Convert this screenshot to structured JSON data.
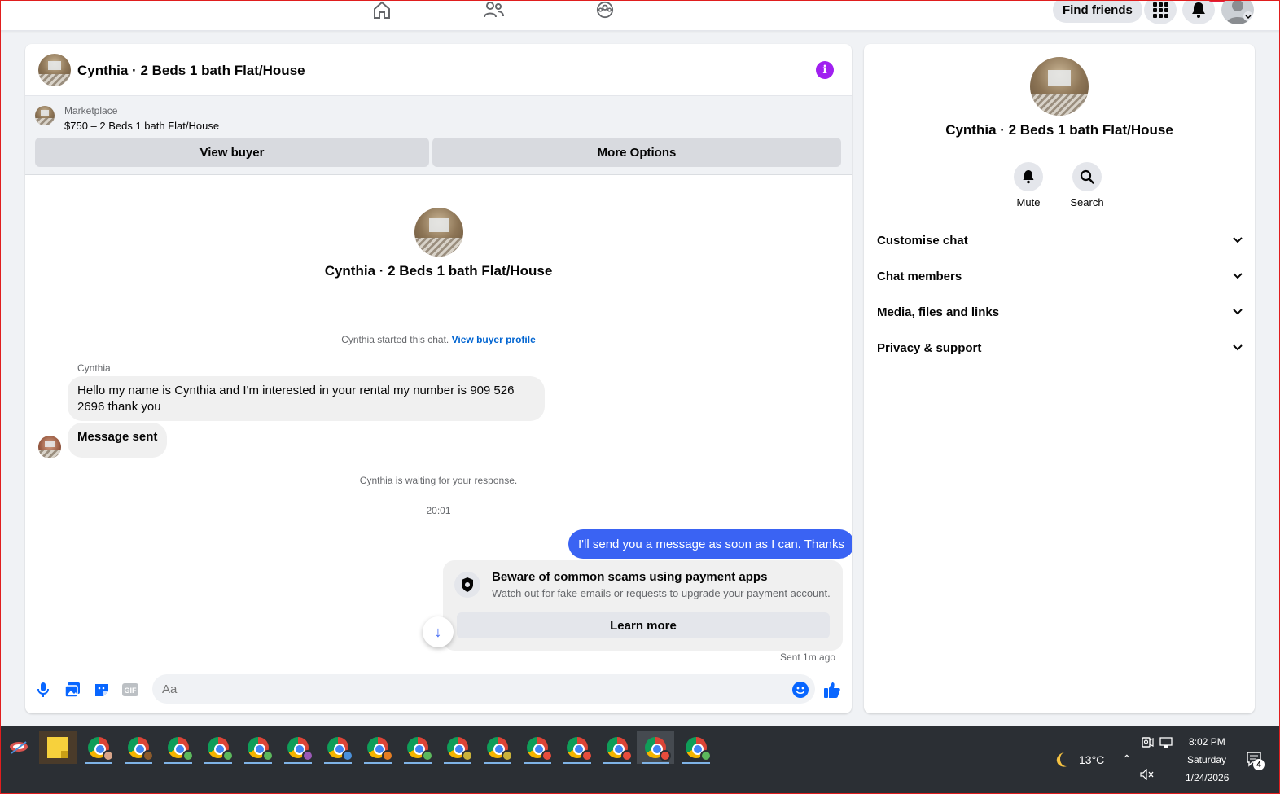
{
  "top_nav": {
    "find_friends_label": "Find friends"
  },
  "chat": {
    "title": "Cynthia · 2 Beds 1 bath Flat/House",
    "marketplace": {
      "label": "Marketplace",
      "listing": "$750 – 2 Beds 1 bath Flat/House",
      "view_buyer_label": "View buyer",
      "more_options_label": "More Options"
    },
    "conversation_title": "Cynthia · 2 Beds 1 bath Flat/House",
    "started_text": "Cynthia started this chat.",
    "view_buyer_profile_label": "View buyer profile",
    "sender_name": "Cynthia",
    "incoming_message": "Hello my name is Cynthia and I'm interested in your rental my number is 909 526 2696 thank you",
    "message_sent_label": "Message sent",
    "waiting_text": "Cynthia is waiting for your response.",
    "timestamp": "20:01",
    "outgoing_message": "I'll send you a message as soon as I can. Thanks",
    "scam_warning": {
      "title": "Beware of common scams using payment apps",
      "subtitle": "Watch out for fake emails or requests to upgrade your payment account.",
      "learn_more_label": "Learn more"
    },
    "sent_status": "Sent 1m ago",
    "composer_placeholder": "Aa"
  },
  "info_panel": {
    "title": "Cynthia · 2 Beds 1 bath Flat/House",
    "mute_label": "Mute",
    "search_label": "Search",
    "sections": [
      "Customise chat",
      "Chat members",
      "Media, files and links",
      "Privacy & support"
    ]
  },
  "taskbar": {
    "temperature": "13°C",
    "time": "8:02 PM",
    "day": "Saturday",
    "date": "1/24/2026",
    "notification_count": "4"
  },
  "colors": {
    "accent": "#0866ff",
    "outgoing_bubble": "#3a63f3",
    "info_icon": "#a020f0"
  }
}
